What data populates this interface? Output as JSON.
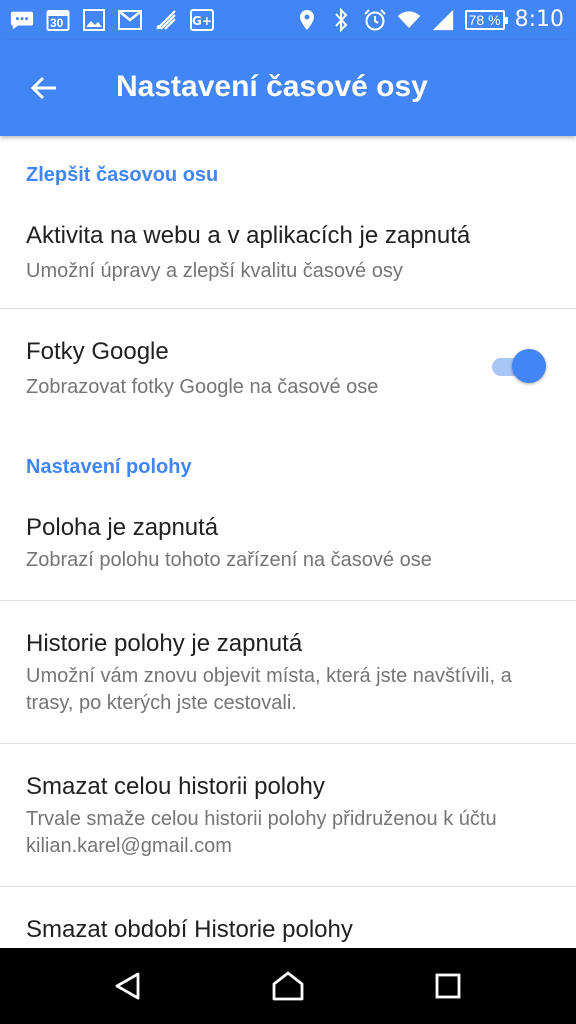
{
  "status_bar": {
    "left_icons": [
      "message-icon",
      "calendar-icon",
      "image-icon",
      "gmail-icon",
      "hangouts-icon",
      "google-plus-icon"
    ],
    "calendar_day": "30",
    "battery_percent": "78 %",
    "time": "8:10"
  },
  "app_bar": {
    "title": "Nastavení časové osy",
    "back_icon": "arrow-left-icon"
  },
  "sections": {
    "improve": {
      "header": "Zlepšit časovou osu",
      "activity_title": "Aktivita na webu a v aplikacích je zapnutá",
      "activity_sub": "Umožní úpravy a zlepší kvalitu časové osy",
      "photos_title": "Fotky Google",
      "photos_sub": "Zobrazovat fotky Google na časové ose",
      "photos_enabled": true
    },
    "location": {
      "header": "Nastavení polohy",
      "location_title": "Poloha je zapnutá",
      "location_sub": "Zobrazí polohu tohoto zařízení na časové ose",
      "history_title": "Historie polohy je zapnutá",
      "history_sub": "Umožní vám znovu objevit místa, která jste navštívili, a trasy, po kterých jste cestovali.",
      "delete_all_title": "Smazat celou historii polohy",
      "delete_all_sub": "Trvale smaže celou historii polohy přidruženou k účtu kilian.karel@gmail.com",
      "delete_range_title": "Smazat období Historie polohy"
    }
  },
  "colors": {
    "primary": "#4285f4",
    "toggle_track": "#a9c6f7",
    "title_text": "#212121",
    "subtitle_text": "#757575"
  },
  "nav_bar": {
    "icons": [
      "back-triangle-icon",
      "home-icon",
      "recents-icon"
    ]
  }
}
